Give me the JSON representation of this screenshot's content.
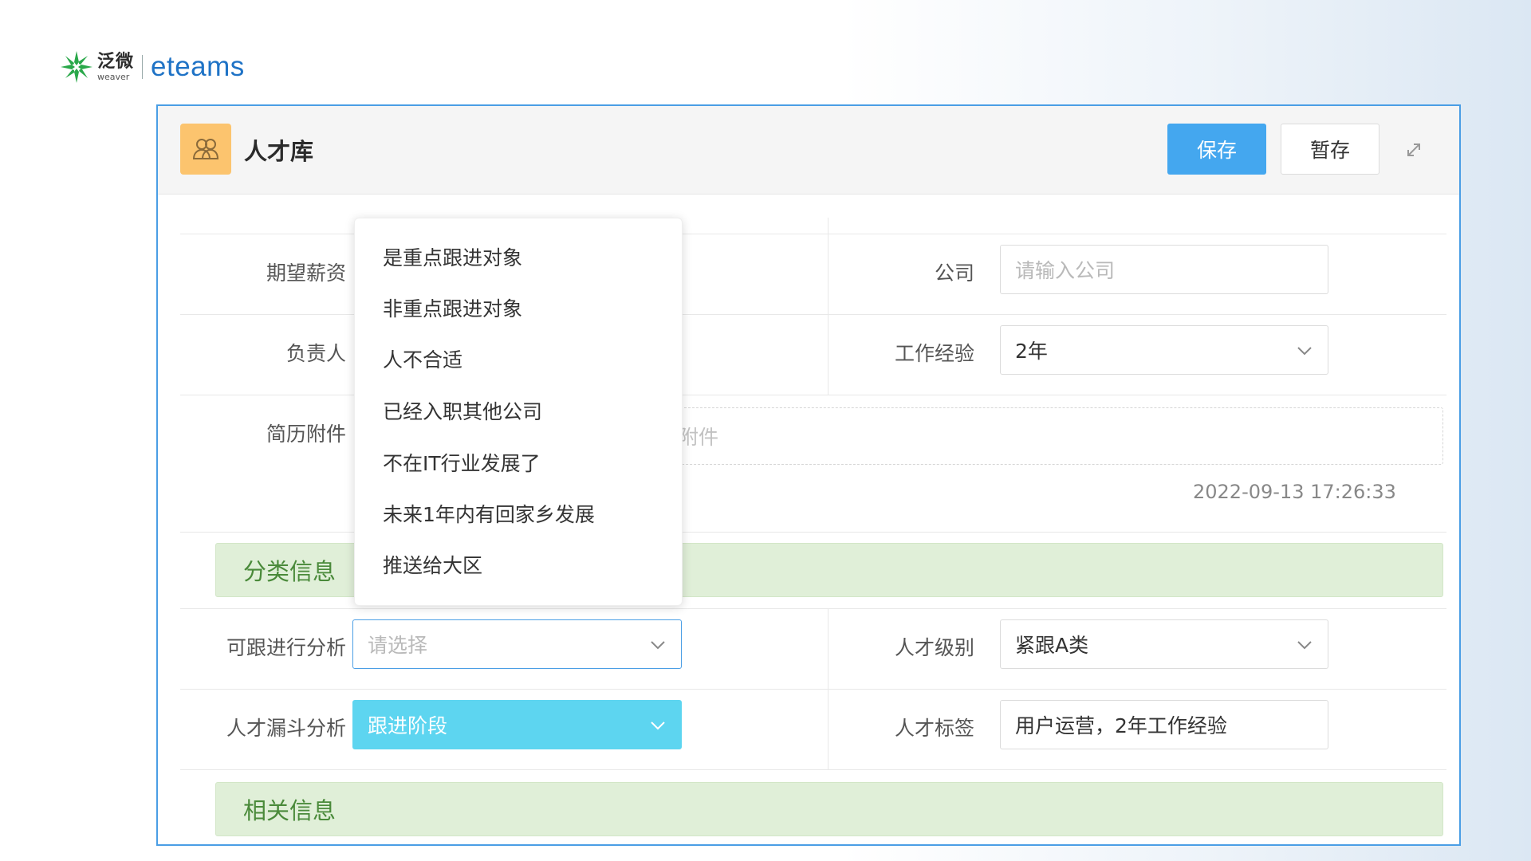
{
  "logo": {
    "cn": "泛微",
    "en": "weaver",
    "brand": "eteams"
  },
  "header": {
    "title": "人才库",
    "save_label": "保存",
    "draft_label": "暂存"
  },
  "form": {
    "expected_salary_label": "期望薪资",
    "company_label": "公司",
    "company_placeholder": "请输入公司",
    "owner_label": "负责人",
    "experience_label": "工作经验",
    "experience_value": "2年",
    "resume_label": "简历附件",
    "resume_placeholder": "附件",
    "timestamp": "2022-09-13 17:26:33",
    "section_category": "分类信息",
    "follow_analysis_label": "可跟进行分析",
    "follow_analysis_placeholder": "请选择",
    "talent_level_label": "人才级别",
    "talent_level_value": "紧跟A类",
    "funnel_label": "人才漏斗分析",
    "funnel_value": "跟进阶段",
    "tags_label": "人才标签",
    "tags_value": "用户运营，2年工作经验",
    "section_related": "相关信息"
  },
  "dropdown": {
    "options": [
      "是重点跟进对象",
      "非重点跟进对象",
      "人不合适",
      "已经入职其他公司",
      "不在IT行业发展了",
      "未来1年内有回家乡发展",
      "推送给大区"
    ]
  },
  "colors": {
    "primary": "#44a7ef",
    "accent_cyan": "#5dd5f0",
    "section_bg": "#e0efd8",
    "app_icon": "#fcc46e"
  }
}
